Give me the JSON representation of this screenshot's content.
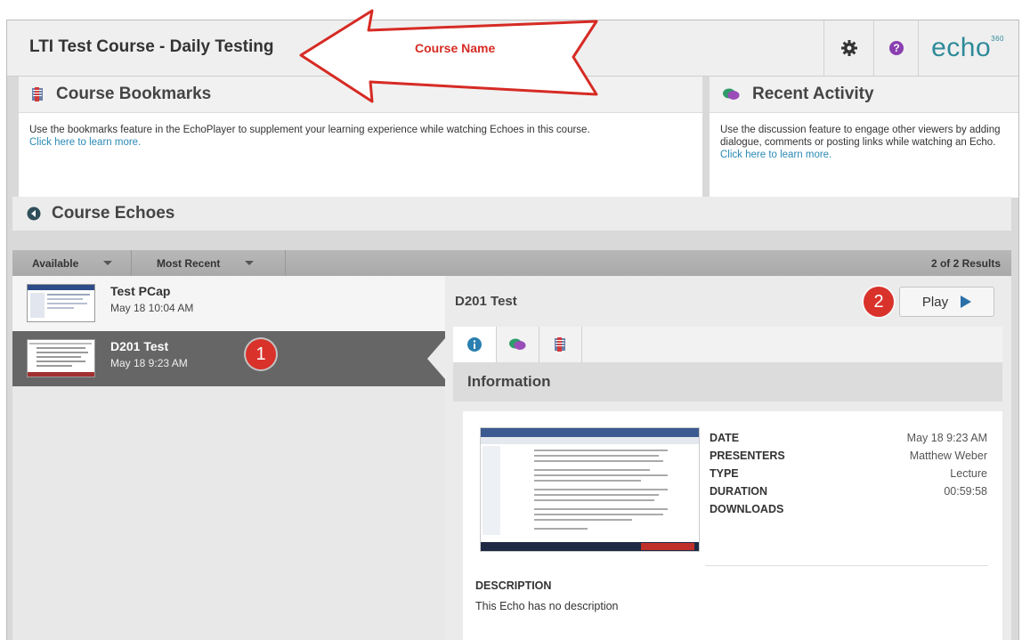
{
  "header": {
    "course_title": "LTI Test Course - Daily Testing",
    "logo_text": "echo",
    "logo_sup": "360",
    "annotation_label": "Course Name"
  },
  "bookmarks": {
    "title": "Course Bookmarks",
    "body": "Use the bookmarks feature in the EchoPlayer to supplement your learning experience while watching Echoes in this course.",
    "link": "Click here to learn more."
  },
  "activity": {
    "title": "Recent Activity",
    "body": "Use the discussion feature to engage other viewers by adding dialogue, comments or posting links while watching an Echo.",
    "link": "Click here to learn more."
  },
  "echoes": {
    "title": "Course Echoes",
    "filter_available": "Available",
    "filter_sort": "Most Recent",
    "results": "2 of 2 Results",
    "items": [
      {
        "title": "Test PCap",
        "date": "May 18 10:04 AM"
      },
      {
        "title": "D201 Test",
        "date": "May 18 9:23 AM"
      }
    ]
  },
  "detail": {
    "title": "D201 Test",
    "play_label": "Play",
    "section": "Information",
    "meta": [
      {
        "key": "DATE",
        "value": "May 18 9:23 AM"
      },
      {
        "key": "PRESENTERS",
        "value": "Matthew Weber"
      },
      {
        "key": "TYPE",
        "value": "Lecture"
      },
      {
        "key": "DURATION",
        "value": "00:59:58"
      },
      {
        "key": "DOWNLOADS",
        "value": ""
      }
    ],
    "description_label": "DESCRIPTION",
    "description": "This Echo has no description"
  },
  "badges": {
    "one": "1",
    "two": "2"
  },
  "colors": {
    "accent": "#2f8a9a",
    "link": "#2a8ab5",
    "badge": "#d9322b",
    "arrow": "#d62b24",
    "selected": "#666666"
  }
}
